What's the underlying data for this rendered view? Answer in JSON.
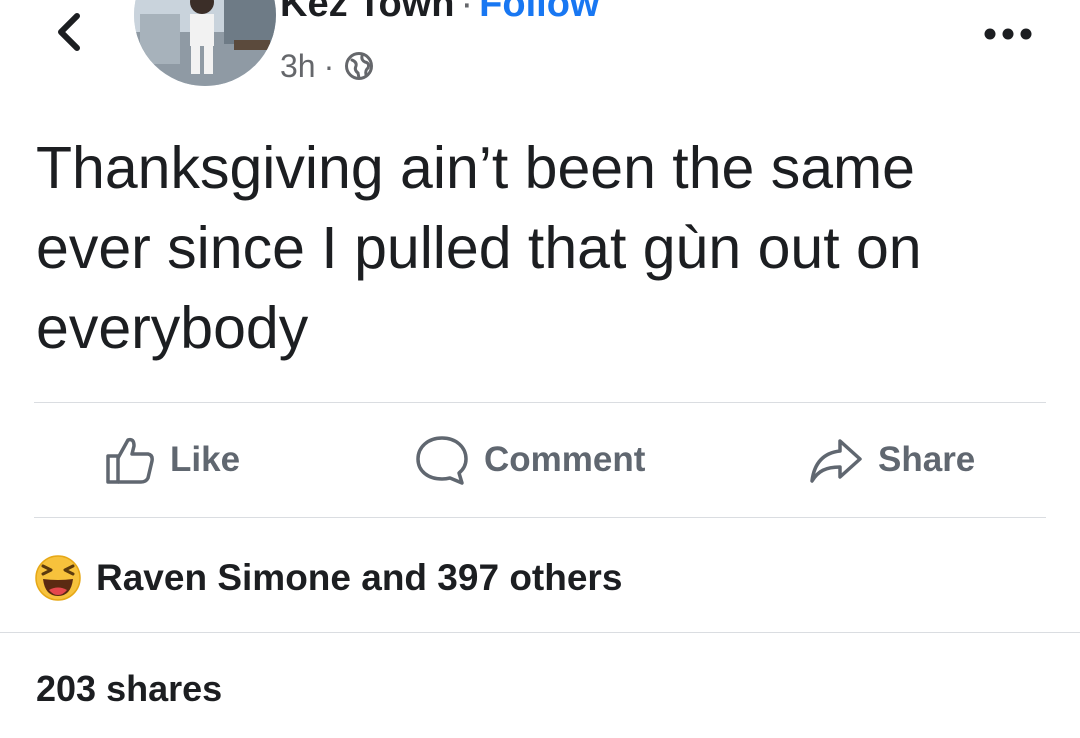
{
  "header": {
    "author_name": "Kez Town",
    "separator": "·",
    "follow_label": "Follow",
    "timestamp": "3h",
    "meta_separator": "·",
    "privacy_icon": "globe-icon",
    "more_icon": "more-dots-icon",
    "back_icon": "chevron-left-icon"
  },
  "post": {
    "text": "Thanksgiving ain’t been the same ever since I pulled that gùn out on everybody"
  },
  "actions": {
    "like_label": "Like",
    "comment_label": "Comment",
    "share_label": "Share"
  },
  "reactions": {
    "icon": "laughing-emoji-icon",
    "summary": "Raven Simone and 397 others"
  },
  "shares": {
    "label": "203 shares"
  },
  "colors": {
    "accent": "#1877f2",
    "text": "#1c1e21",
    "muted": "#65676b",
    "divider": "#dadde1",
    "emoji_yellow": "#f7c23c"
  }
}
